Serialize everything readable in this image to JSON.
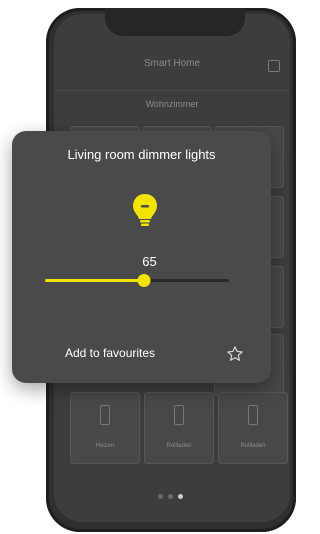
{
  "app": {
    "title": "Smart Home",
    "room": "Wohnzimmer"
  },
  "tiles": [
    {
      "label": "Heizen"
    },
    {
      "label": "Rollladen"
    },
    {
      "label": "Rollladen"
    }
  ],
  "pager": {
    "count": 3,
    "active_index": 2
  },
  "dimmer": {
    "title": "Living room dimmer lights",
    "level_label": "65",
    "level_percent": 65,
    "favourite_label": "Add to favourites"
  },
  "colors": {
    "accent": "#f2e400",
    "card": "#4a4a4a",
    "screen": "#3d3d3d"
  },
  "icons": {
    "bulb": "lightbulb-icon",
    "star": "star-outline-icon",
    "home": "home-icon"
  }
}
